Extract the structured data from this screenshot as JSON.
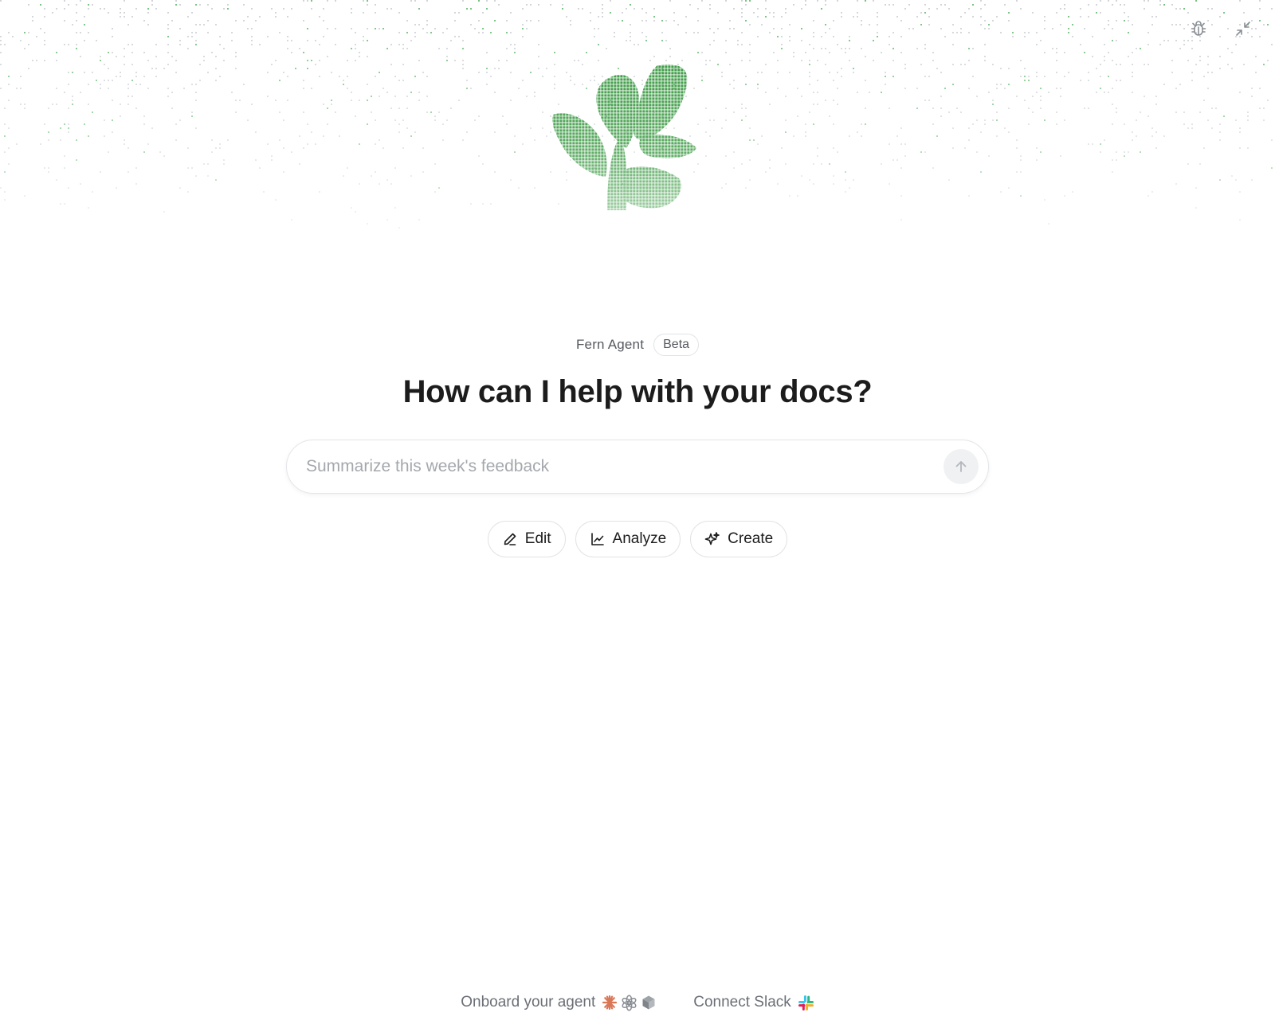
{
  "header": {
    "report_bug_label": "Report a bug",
    "minimize_label": "Minimize"
  },
  "agent": {
    "name": "Fern Agent",
    "badge": "Beta"
  },
  "headline": "How can I help with your docs?",
  "composer": {
    "placeholder": "Summarize this week's feedback",
    "value": ""
  },
  "chips": [
    {
      "label": "Edit",
      "icon": "pencil-icon"
    },
    {
      "label": "Analyze",
      "icon": "line-chart-icon"
    },
    {
      "label": "Create",
      "icon": "sparkle-icon"
    }
  ],
  "footer": {
    "onboard_label": "Onboard your agent",
    "onboard_icons": [
      "claude-icon",
      "openai-icon",
      "cube-icon"
    ],
    "slack_label": "Connect Slack",
    "slack_icon": "slack-icon"
  },
  "colors": {
    "brand_green": "#3fa34d",
    "text_primary": "#1c1c1c",
    "text_muted": "#6b7076",
    "placeholder": "#a4a8ad",
    "border": "#e1e3e6"
  }
}
